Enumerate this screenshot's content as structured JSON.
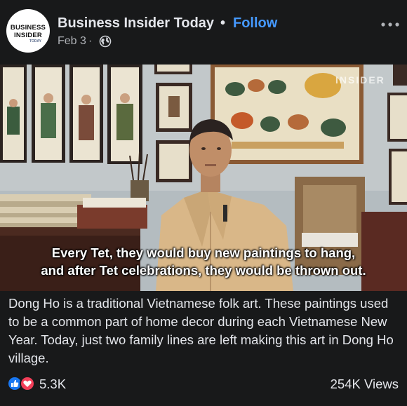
{
  "header": {
    "avatar_line1": "BUSINESS",
    "avatar_line2": "INSIDER",
    "avatar_sub": "TODAY",
    "page_name": "Business Insider Today",
    "separator": "•",
    "follow_label": "Follow",
    "date": "Feb 3",
    "date_separator": "·",
    "privacy_icon": "globe-icon",
    "more_icon": "more-horizontal-icon"
  },
  "video": {
    "watermark": "INSIDER",
    "caption_line1": "Every Tet, they would buy new paintings to hang,",
    "caption_line2": "and after Tet celebrations, they would be thrown out."
  },
  "description": "Dong Ho is a traditional Vietnamese folk art. These paintings used to be a common part of home decor during each Vietnamese New Year. Today, just two family lines are left making this art in Dong Ho village.",
  "footer": {
    "reaction_icons": [
      "like-icon",
      "love-icon"
    ],
    "reaction_count": "5.3K",
    "views": "254K Views"
  },
  "colors": {
    "background": "#18191a",
    "text": "#e4e6eb",
    "secondary_text": "#b0b3b8",
    "link": "#4599ff",
    "like": "#1877f2",
    "love": "#f33e58"
  }
}
